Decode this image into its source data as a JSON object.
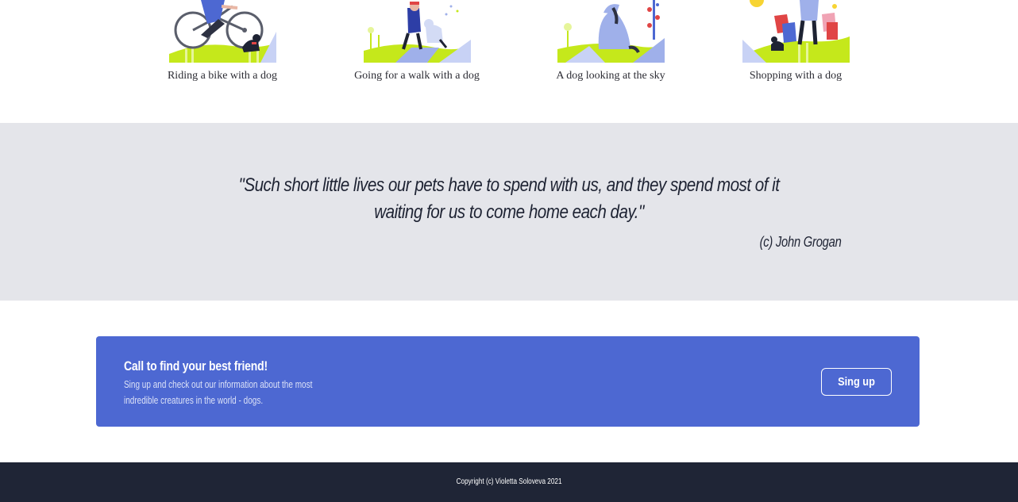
{
  "gallery": {
    "items": [
      {
        "caption": "Riding a bike with a dog",
        "icon": "bike-dog-illustration"
      },
      {
        "caption": "Going for a walk with a dog",
        "icon": "walk-dog-illustration"
      },
      {
        "caption": "A dog looking at the sky",
        "icon": "dog-sky-illustration"
      },
      {
        "caption": "Shopping with a dog",
        "icon": "shopping-dog-illustration"
      }
    ]
  },
  "quote": {
    "text": "\"Such short little lives our pets have to spend with us, and they spend most of it waiting for us to come home each day.\"",
    "author": "(c) John Grogan"
  },
  "cta": {
    "title": "Call to find your best friend!",
    "text": "Sing up and check out our information about the most indredible creatures in the world - dogs.",
    "button_label": "Sing up"
  },
  "footer": {
    "copyright": "Copyright (c) Violetta Soloveva 2021"
  },
  "colors": {
    "accent": "#4d68d2",
    "quote_bg": "#e4e5ea",
    "footer_bg": "#1f2536",
    "lime": "#c5e81b"
  }
}
